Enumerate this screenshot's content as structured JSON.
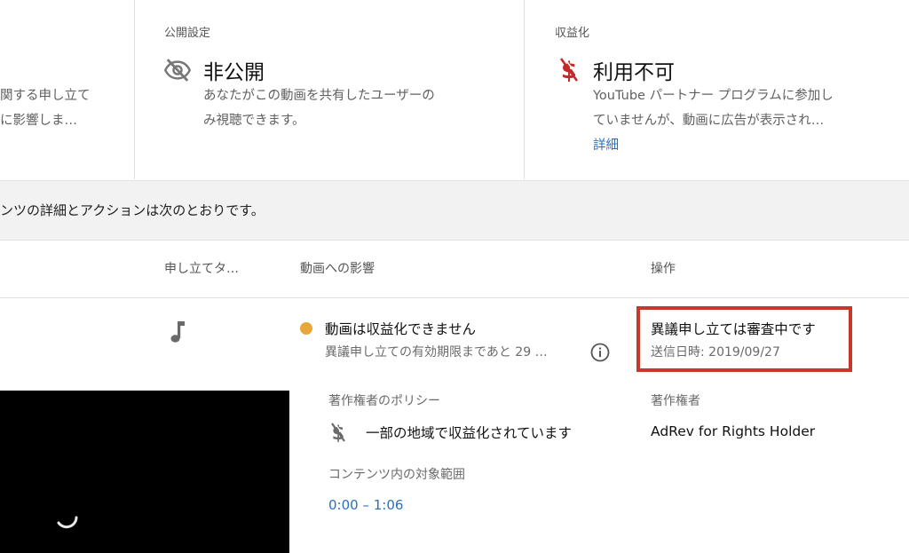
{
  "summary": {
    "left_desc_line1": "関する申し立て",
    "left_desc_line2": "に影響しま…",
    "visibility": {
      "label": "公開設定",
      "value": "非公開",
      "icon": "eye-off-icon",
      "desc_line1": "あなたがこの動画を共有したユーザーの",
      "desc_line2": "み視聴できます。"
    },
    "monetization": {
      "label": "収益化",
      "value": "利用不可",
      "icon": "dollar-off-icon",
      "accent": "#c62828",
      "desc_line1": "YouTube パートナー プログラムに参加し",
      "desc_line2": "ていませんが、動画に広告が表示され…",
      "link": "詳細"
    }
  },
  "band_text": "ンツの詳細とアクションは次のとおりです。",
  "table": {
    "headers": {
      "claim_type": "申し立てタ…",
      "impact": "動画への影響",
      "actions": "操作"
    },
    "row": {
      "claim_icon": "music-note-icon",
      "impact_dot_color": "#e8a838",
      "impact_title": "動画は収益化できません",
      "impact_sub": "異議申し立ての有効期限まであと 29 …",
      "info_icon": "info-icon",
      "action_title": "異議申し立ては審査中です",
      "action_sub": "送信日時: 2019/09/27",
      "policy_label": "著作権者のポリシー",
      "policy_icon": "dollar-off-icon",
      "policy_value": "一部の地域で収益化されています",
      "owner_label": "著作権者",
      "owner_value": "AdRev for Rights Holder",
      "range_label": "コンテンツ内の対象範囲",
      "range_value": "0:00 – 1:06"
    }
  },
  "video": {
    "spinner_icon": "loading-spinner-icon"
  }
}
